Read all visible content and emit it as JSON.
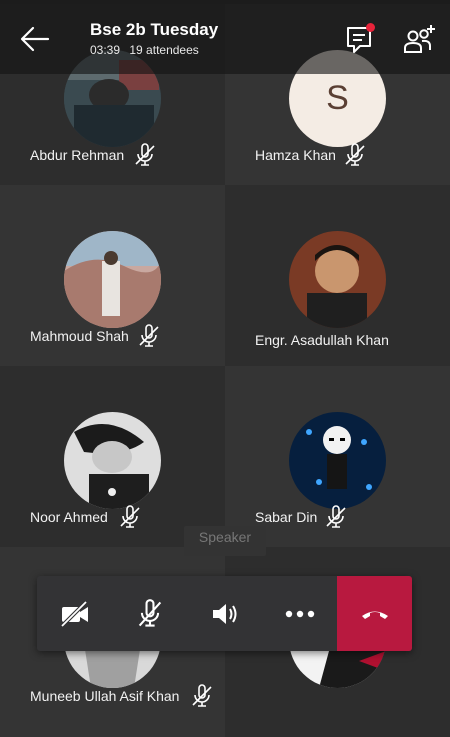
{
  "meeting": {
    "title": "Bse 2b Tuesday",
    "duration": "03:39",
    "attendees": "19 attendees"
  },
  "participants": [
    {
      "name": "Abdur Rehman",
      "muted": true
    },
    {
      "name": "Hamza Khan",
      "muted": true,
      "initial": "S"
    },
    {
      "name": "Mahmoud Shah",
      "muted": true
    },
    {
      "name": "Engr. Asadullah  Khan",
      "muted": false
    },
    {
      "name": "Noor Ahmed",
      "muted": true
    },
    {
      "name": "Sabar Din",
      "muted": true
    },
    {
      "name": "Muneeb Ullah Asif Khan",
      "muted": true
    }
  ],
  "speaker_label": "Speaker",
  "callbar": {
    "camera": "camera-off-icon",
    "mic": "mic-off-icon",
    "speaker": "speaker-icon",
    "more": "more-icon",
    "hangup": "hangup-icon"
  },
  "colors": {
    "hangup": "#b8193f",
    "notification": "#e8233a"
  }
}
